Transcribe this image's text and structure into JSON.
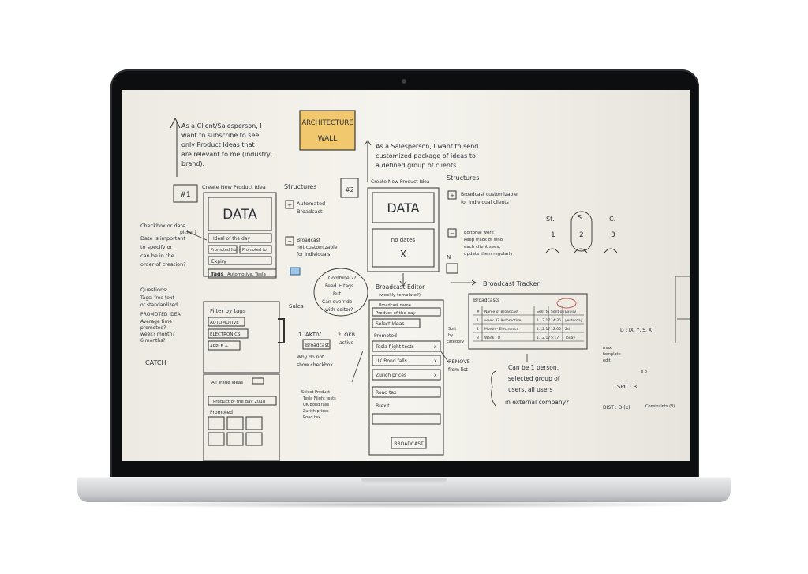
{
  "whiteboard": {
    "architecture_label_1": "ARCHITECTURE",
    "architecture_label_2": "WALL",
    "story1": [
      "As a Client/Salesperson, I",
      "want to subscribe to see",
      "only Product Ideas that",
      "are relevant to me (industry,",
      "brand)."
    ],
    "story2": [
      "As a Salesperson, I want to send",
      "customized package of ideas to",
      "a defined group of clients."
    ],
    "wireframe1": {
      "id": "#1",
      "title": "Create New Product Idea",
      "data_label": "DATA",
      "field1": "Ideal of the day",
      "field2a": "Promoted from",
      "field2b": "Promoted to",
      "field3": "Expiry",
      "tags_label": "Tags",
      "tags_value": "Automotive, Tesla"
    },
    "structures1": {
      "title": "Structures",
      "item1": [
        "Automated",
        "Broadcast"
      ],
      "item2": [
        "Broadcast",
        "not customizable",
        "for individuals"
      ]
    },
    "left_notes": {
      "checkbox": [
        "Checkbox or date",
        "picker?"
      ],
      "date": [
        "Date is important",
        "to specify or",
        "can be in the",
        "order of creation?"
      ],
      "questions": [
        "Questions:",
        "Tags: free text",
        "or standardized",
        "PROMOTED IDEA:",
        "Average time",
        "promoted?",
        "week? month?",
        "6 months?"
      ],
      "catch": "CATCH"
    },
    "filter": {
      "title": "Filter by tags",
      "rows": [
        "AUTOMOTIVE",
        "ELECTRONICS",
        "APPLE +"
      ],
      "sales": "Sales"
    },
    "bottom_left": {
      "title": "All Trade Ideas",
      "product": "Product of the day 2018",
      "promoted": "Promoted"
    },
    "middle": {
      "combine": [
        "Combine 2?",
        "Feed + tags",
        "But",
        "Can override",
        "with editor?"
      ],
      "aktiv": "1. AKTIV",
      "broadcast_btn": "Broadcast",
      "okb": [
        "2. OKB",
        "active"
      ],
      "note": [
        "Why do not",
        "show checkbox"
      ],
      "select_product": [
        "Select Product",
        "Tesla Flight tests",
        "UK Bond falls",
        "Zurich prices",
        "Road tax"
      ]
    },
    "wireframe2": {
      "id": "#2",
      "title": "Create New Product Idea",
      "data_label": "DATA",
      "no_dates": "no dates",
      "no_dates_x": "X"
    },
    "structures2": {
      "title": "Structures",
      "item1": [
        "Broadcast customizable",
        "for individual clients"
      ],
      "item2": [
        "Editorial work",
        "keep track of who",
        "each client sees,",
        "update them regularly"
      ],
      "n_label": "N"
    },
    "editor": {
      "title": "Broadcast Editor",
      "subtitle": "(weekly template?)",
      "header": "Broadcast name",
      "product": "Product of the day",
      "select": "Select Ideas",
      "promoted": "Promoted",
      "items": [
        "Tesla flight tests",
        "UK Bond falls",
        "Zurich prices",
        "Road tax",
        "Brexit"
      ],
      "remove": [
        "REMOVE",
        "from list"
      ],
      "button": "BROADCAST"
    },
    "tracker": {
      "title": "Broadcast Tracker",
      "header": "Broadcasts",
      "columns": [
        "#",
        "Name of Broadcast",
        "Sent to",
        "Sent on",
        "Expiry"
      ],
      "rows": [
        [
          "1",
          "week 32 Automotive",
          "1.12.17",
          "14:35",
          "yesterday"
        ],
        [
          "2",
          "Month - Electronics",
          "1.12.17",
          "12:05",
          "2d"
        ],
        [
          "3",
          "Week - IT",
          "1.12.17",
          "5:17",
          "Today"
        ]
      ],
      "side": [
        "Sort",
        "by",
        "category"
      ]
    },
    "bottom_right": [
      "Can be 1 person,",
      "selected group of",
      "users, all users",
      "in external company?"
    ],
    "personas": [
      "St.",
      "S.",
      "C.",
      "1",
      "2",
      "3"
    ],
    "right_edge": {
      "formula1": "D : [X, Y, S, X]",
      "spc": "SPC : B",
      "dist": "DIST : D (x)",
      "max": [
        "max",
        "template",
        "edit"
      ],
      "n_words": "n p",
      "constr": "Constraints (3)"
    }
  }
}
